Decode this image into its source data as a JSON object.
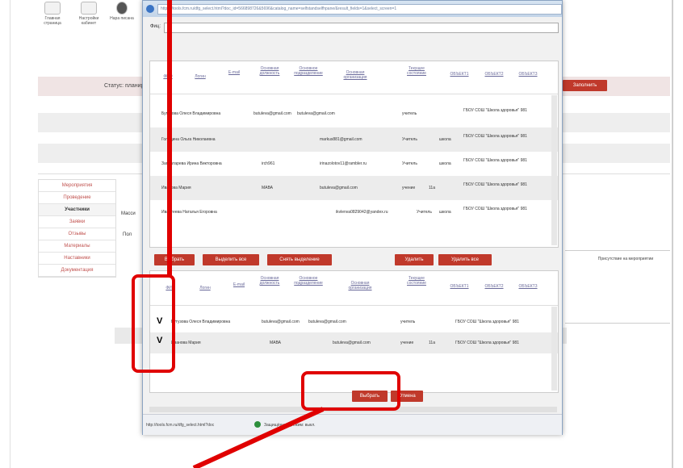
{
  "toolbar": {
    "items": [
      {
        "label": "Главная страница",
        "icon": "home-icon"
      },
      {
        "label": "Настройки кабинет",
        "icon": "envelope-icon"
      },
      {
        "label": "Нара писана",
        "icon": "person-icon"
      }
    ]
  },
  "status_bar_text": "Статус: планирует",
  "top_right_button": "Заполнить",
  "sidebar": {
    "items": [
      {
        "label": "Мероприятия",
        "active": false
      },
      {
        "label": "Проведение",
        "active": false
      },
      {
        "label": "Участники",
        "active": true
      },
      {
        "label": "Заявки",
        "active": false
      },
      {
        "label": "Отзывы",
        "active": false
      },
      {
        "label": "Материалы",
        "active": false
      },
      {
        "label": "Наставники",
        "active": false
      },
      {
        "label": "Документация",
        "active": false
      }
    ]
  },
  "bg_side_labels": {
    "massive": "Масси",
    "checkbox": "Пол",
    "right_col": "Присутствие на мероприятии"
  },
  "modal": {
    "url": "https://tools.fcm.ru/dfg_select.html?doc_id=566898726&5696&catalog_name=selfstandselfhpane/&result_fields=1&select_screen=1",
    "search_label": "Фиц:",
    "upper_table": {
      "columns": [
        "ФИО",
        "Логин",
        "E-mail",
        "Основная должность",
        "Основное подразделение",
        "Основная организация",
        "Текущее состояние",
        "ОБЪЕКТ1",
        "ОБЪЕКТ2",
        "ОБЪЕКТ3"
      ],
      "rows": [
        {
          "name": "Бутузова Олеся Владимировна",
          "login": "butuleva@gmail.com",
          "email": "butuleva@gmail.com",
          "position": "учитель",
          "dept": "",
          "org": "ГБОУ СОШ \"Школа здоровья\" 981"
        },
        {
          "name": "Голодина Ольга Николаевна",
          "login": "",
          "email": "markus881@gmail.com",
          "position": "Учитель",
          "dept": "школа",
          "org": "ГБОУ СОШ \"Школа здоровья\" 981"
        },
        {
          "name": "Заплатарева Ирина Викторовна",
          "login": "irch961",
          "email": "irinazolotov11@rambler.ru",
          "position": "Учитель",
          "dept": "школа",
          "org": "ГБОУ СОШ \"Школа здоровья\" 981"
        },
        {
          "name": "Иванова Мария",
          "login": "МАВА",
          "email": "butuleva@gmail.com",
          "position": "учение",
          "dept": "11а",
          "org": "ГБОУ СОШ \"Школа здоровья\" 981"
        },
        {
          "name": "Ивантеева Наталья Егоровна",
          "login": "",
          "email": "ikvlenva0829042@yandex.ru",
          "position": "Учитель",
          "dept": "школа",
          "org": "ГБОУ СОШ \"Школа здоровья\" 981"
        }
      ]
    },
    "action_buttons": {
      "select": "Выбрать",
      "select_all": "Выделить все",
      "deselect": "Снять выделение",
      "delete": "Удалить",
      "delete_all": "Удалить все"
    },
    "lower_table": {
      "columns": [
        "ФИО",
        "Логин",
        "E-mail",
        "Основная должность",
        "Основное подразделение",
        "Основная организация",
        "Текущее состояние",
        "ОБЪЕКТ1",
        "ОБЪЕКТ2",
        "ОБЪЕКТ3"
      ],
      "rows": [
        {
          "check": "V",
          "name": "Бутузова Олеся Владимировна",
          "login": "butuleva@gmail.com",
          "email": "butuleva@gmail.com",
          "position": "учитель",
          "dept": "",
          "org": "ГБОУ СОШ \"Школа здоровья\" 981"
        },
        {
          "check": "V",
          "name": "Иванова Мария",
          "login": "МАВА",
          "email": "butuleva@gmail.com",
          "position": "учение",
          "dept": "11а",
          "org": "ГБОУ СОШ \"Школа здоровья\" 981"
        }
      ]
    },
    "footer_buttons": {
      "ok": "Выбрать",
      "cancel": "Отмена"
    },
    "status_url": "http://tools.fcm.ru/dfg_select.html?doc",
    "status_text": "Защищённый режим: выкл."
  },
  "colors": {
    "accent_red": "#c0392b",
    "highlight_red": "#e00000"
  }
}
